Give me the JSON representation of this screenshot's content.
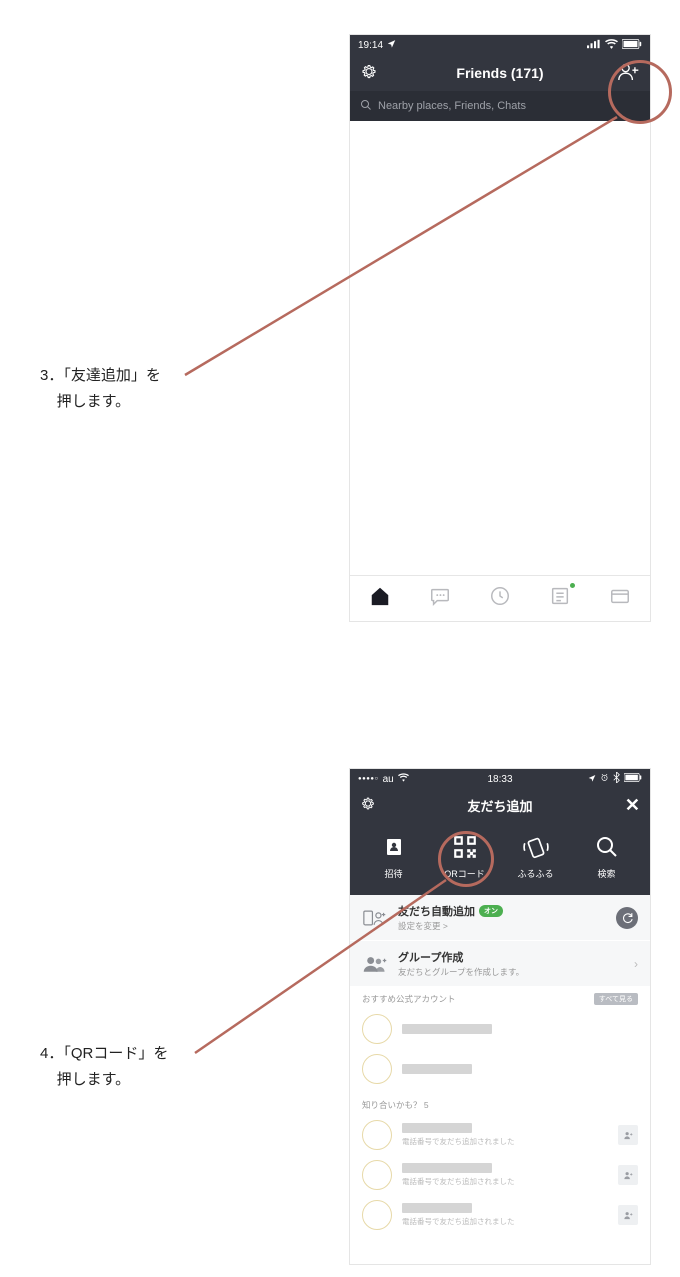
{
  "captions": {
    "c3_num": "3．",
    "c3_l1": "「友達追加」を",
    "c3_l2": "押します。",
    "c4_num": "4．",
    "c4_l1": "「QRコード」を",
    "c4_l2": "押します。"
  },
  "phone1": {
    "status": {
      "time": "19:14",
      "location_arrow": "↗"
    },
    "header_title": "Friends (171)",
    "search_placeholder": "Nearby places, Friends, Chats"
  },
  "phone2": {
    "status": {
      "carrier_dots": "●●●●○",
      "carrier": "au",
      "time": "18:33"
    },
    "title": "友だち追加",
    "options": {
      "invite": "招待",
      "qr": "QRコード",
      "shake": "ふるふる",
      "search": "検索"
    },
    "row_auto": {
      "title": "友だち自動追加",
      "badge": "オン",
      "sub": "設定を変更 >"
    },
    "row_group": {
      "title": "グループ作成",
      "sub": "友だちとグループを作成します。"
    },
    "section_reco": {
      "title": "おすすめ公式アカウント",
      "more": "すべて見る"
    },
    "section_maybe": {
      "title": "知り合いかも？ 5"
    },
    "subnote": "電話番号で友だち追加されました"
  }
}
